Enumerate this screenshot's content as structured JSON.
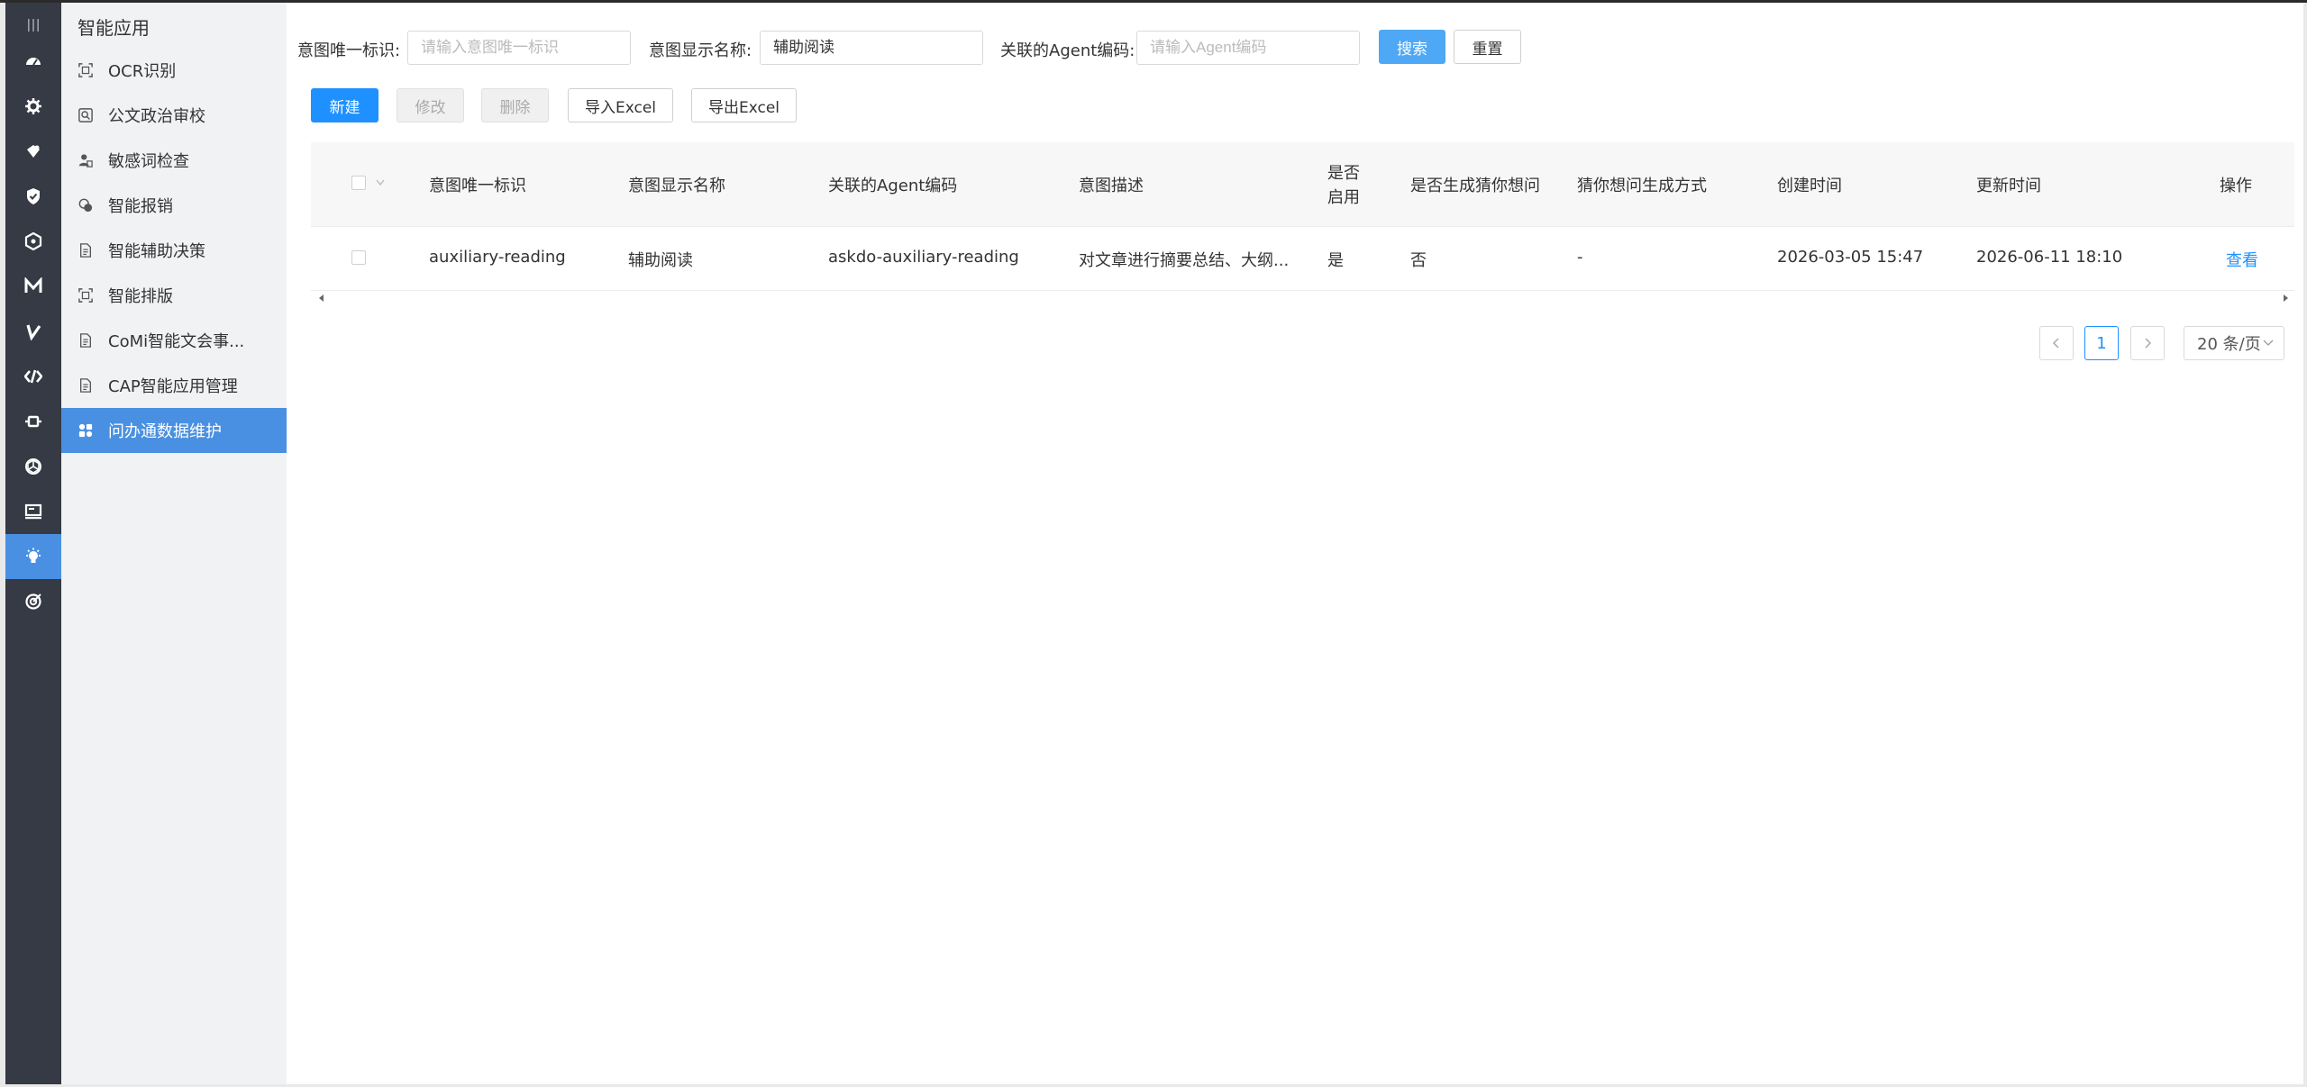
{
  "rail": {
    "icons": [
      "menu-icon",
      "dashboard-icon",
      "settings-gear-icon",
      "puzzle-icon",
      "shield-check-icon",
      "hexagon-icon",
      "m-logo-icon",
      "v-logo-icon",
      "code-icon",
      "plugin-icon",
      "cube-icon",
      "monitor-icon",
      "lightbulb-icon",
      "target-icon"
    ],
    "active_index": 12
  },
  "sidebar": {
    "title": "智能应用",
    "items": [
      {
        "label": "OCR识别",
        "icon": "scan-icon"
      },
      {
        "label": "公文政治审校",
        "icon": "search-doc-icon"
      },
      {
        "label": "敏感词检查",
        "icon": "user-check-icon"
      },
      {
        "label": "智能报销",
        "icon": "coins-icon"
      },
      {
        "label": "智能辅助决策",
        "icon": "document-icon"
      },
      {
        "label": "智能排版",
        "icon": "scan-icon"
      },
      {
        "label": "CoMi智能文会事...",
        "icon": "document-icon"
      },
      {
        "label": "CAP智能应用管理",
        "icon": "document-icon"
      },
      {
        "label": "问办通数据维护",
        "icon": "apps-icon"
      }
    ],
    "active_index": 8
  },
  "filters": {
    "intent_id_label": "意图唯一标识:",
    "intent_id_placeholder": "请输入意图唯一标识",
    "intent_name_label": "意图显示名称:",
    "intent_name_value": "辅助阅读",
    "agent_code_label": "关联的Agent编码:",
    "agent_code_placeholder": "请输入Agent编码",
    "search_label": "搜索",
    "reset_label": "重置"
  },
  "toolbar": {
    "new_label": "新建",
    "edit_label": "修改",
    "delete_label": "删除",
    "import_label": "导入Excel",
    "export_label": "导出Excel"
  },
  "table": {
    "headers": {
      "intent_id": "意图唯一标识",
      "intent_name": "意图显示名称",
      "agent_code": "关联的Agent编码",
      "description": "意图描述",
      "enabled_line1": "是否",
      "enabled_line2": "启用",
      "guess_enabled": "是否生成猜你想问",
      "guess_mode": "猜你想问生成方式",
      "created": "创建时间",
      "updated": "更新时间",
      "actions": "操作"
    },
    "rows": [
      {
        "intent_id": "auxiliary-reading",
        "intent_name": "辅助阅读",
        "agent_code": "askdo-auxiliary-reading",
        "description": "对文章进行摘要总结、大纲...",
        "enabled": "是",
        "guess_enabled": "否",
        "guess_mode": "-",
        "created": "2026-03-05 15:47",
        "updated": "2026-06-11 18:10",
        "action": "查看"
      }
    ]
  },
  "pagination": {
    "current_page": "1",
    "page_size": "20 条/页"
  }
}
